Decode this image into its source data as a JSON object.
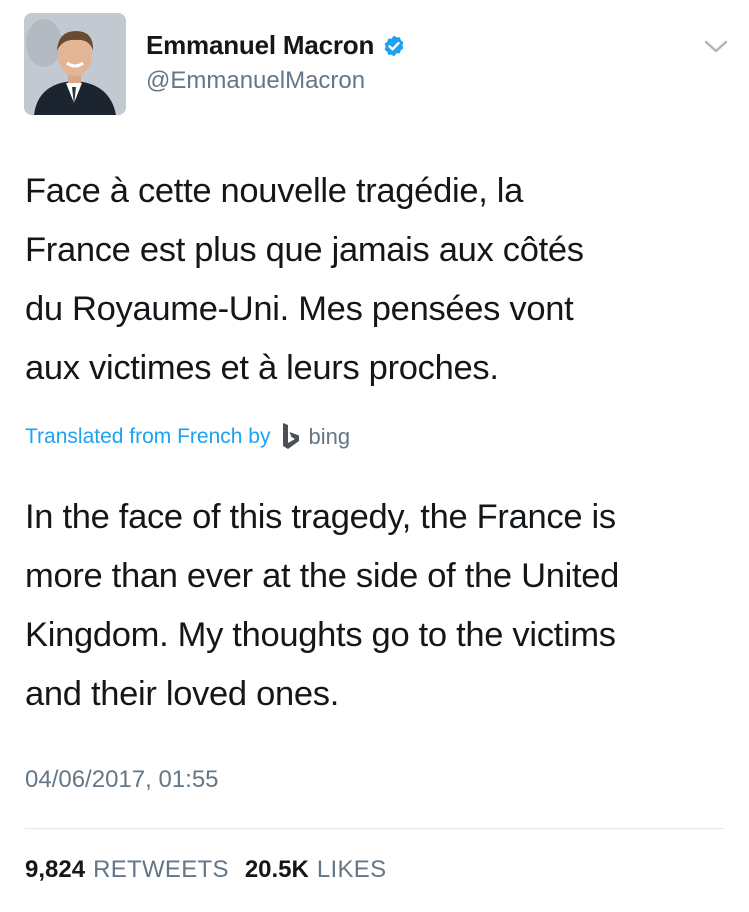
{
  "author": {
    "name": "Emmanuel Macron",
    "handle": "@EmmanuelMacron",
    "avatar": "avatar-photo",
    "verified_icon": "verified-badge-icon"
  },
  "menu_icon": "chevron-down-icon",
  "tweet": {
    "original_lines": [
      "Face à cette nouvelle tragédie, la",
      "France est plus que jamais aux côtés",
      "du Royaume-Uni. Mes pensées vont",
      "aux victimes et à leurs proches."
    ],
    "translation_label": "Translated from French by",
    "translator_name": "bing",
    "translated_lines": [
      "In the face of this tragedy, the France is",
      "more than ever at the side of the United",
      "Kingdom. My thoughts go to the victims",
      "and their loved ones."
    ],
    "timestamp": "04/06/2017, 01:55"
  },
  "stats": {
    "retweets_count": "9,824",
    "retweets_label": "RETWEETS",
    "likes_count": "20.5K",
    "likes_label": "LIKES"
  },
  "colors": {
    "accent": "#1da1f2",
    "secondary_text": "#657786",
    "primary_text": "#14171a",
    "divider": "#e1e8ed"
  }
}
